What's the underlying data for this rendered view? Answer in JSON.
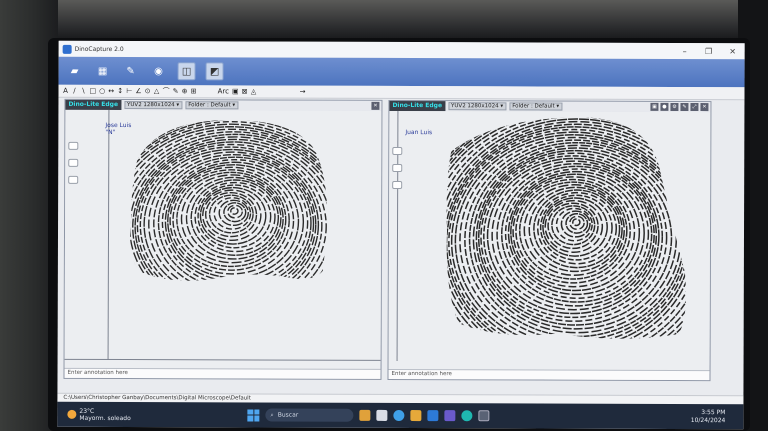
{
  "window": {
    "title": "DinoCapture 2.0"
  },
  "ribbon": {
    "buttons": [
      "folder-icon",
      "gallery-icon",
      "tools-icon",
      "info-icon",
      "live-view-icon",
      "compare-icon"
    ]
  },
  "annotation_tools": {
    "labels": [
      "A",
      "/",
      "\\",
      "□",
      "○",
      "↔",
      "↕",
      "⊢",
      "∠",
      "⊙",
      "△",
      "⌒",
      "✎",
      "⊕",
      "⊞",
      "Arc",
      "▣",
      "⊠",
      "◬",
      "→"
    ]
  },
  "left_pane": {
    "brand": "Dino-Lite Edge",
    "resolution": "YUV2 1280x1024 ▾",
    "folder": "Folder : Default ▾",
    "name_line1": "Jose Luis",
    "name_line2": "\"N\"",
    "annotation_placeholder": "Enter annotation here"
  },
  "right_pane": {
    "brand": "Dino-Lite Edge",
    "resolution": "YUV2 1280x1024 ▾",
    "folder": "Folder : Default ▾",
    "name_line1": "Juan Luis",
    "annotation_placeholder": "Enter annotation here"
  },
  "statusbar": {
    "path": "C:\\Users\\Christopher Ganbay\\Documents\\Digital Microscope\\Default"
  },
  "taskbar": {
    "temperature": "23°C",
    "weather": "Mayorm. soleado",
    "search_label": "Buscar",
    "time": "3:55 PM",
    "date": "10/24/2024"
  },
  "colors": {
    "ribbon": "#4d74bf",
    "brand_text": "#36e0e8",
    "taskbar": "#1f2a3c"
  }
}
